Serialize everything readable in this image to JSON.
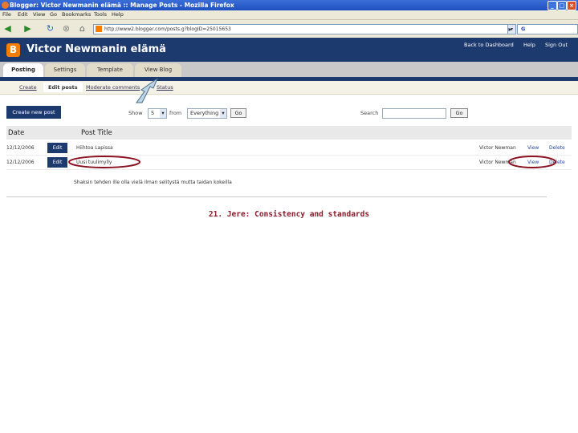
{
  "window": {
    "title": "Blogger: Victor Newmanin elämä :: Manage Posts - Mozilla Firefox",
    "buttons": [
      "_",
      "□",
      "×"
    ]
  },
  "menu": [
    "File",
    "Edit",
    "View",
    "Go",
    "Bookmarks",
    "Tools",
    "Help"
  ],
  "toolbar": {
    "url": "http://www2.blogger.com/posts.g?blogID=25015653",
    "search_engine_label": "G"
  },
  "blog": {
    "logo_letter": "B",
    "title": "Victor Newmanin elämä",
    "header_links": [
      "Back to Dashboard",
      "Help",
      "Sign Out"
    ]
  },
  "tabs": [
    "Posting",
    "Settings",
    "Template",
    "View Blog"
  ],
  "subnav": [
    "Create",
    "Edit posts",
    "Moderate comments",
    "Status"
  ],
  "controls": {
    "create_button": "Create new post",
    "show_label": "Show",
    "show_value": "5",
    "from_label": "from",
    "from_value": "Everything",
    "go_label": "Go",
    "search_label": "Search",
    "search_go": "Go"
  },
  "table": {
    "columns": [
      "Date",
      "Post Title"
    ],
    "rows": [
      {
        "date": "12/12/2006",
        "edit": "Edit",
        "title": "Hiihtoa Lapissa",
        "author": "Victor Newman",
        "view": "View",
        "delete": "Delete"
      },
      {
        "date": "12/12/2006",
        "edit": "Edit",
        "title": "Uusi tuulimylly",
        "author": "Victor Newman",
        "view": "View",
        "delete": "Delete"
      }
    ]
  },
  "note": "Shaksin tehden ille olla vielä ilman selitystä mutta taidan kokeilla",
  "caption": "21. Jere: Consistency and standards",
  "colors": {
    "header_blue": "#1d3a6e",
    "caption_red": "#8b1c2a",
    "highlight_circle": "#8b1020",
    "arrow_fill": "#bcd4e6"
  }
}
